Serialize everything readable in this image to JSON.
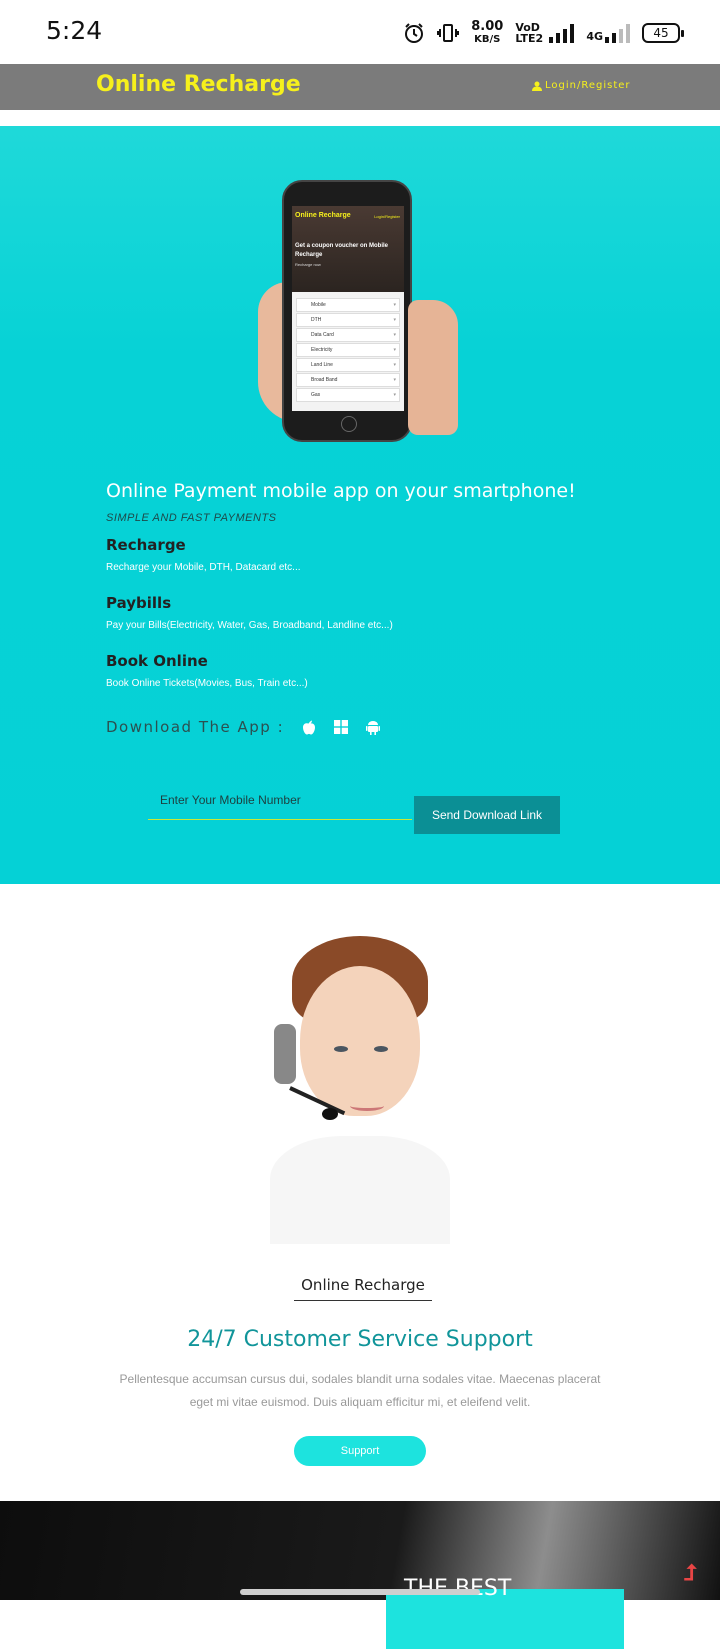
{
  "status": {
    "time": "5:24",
    "speed_value": "8.00",
    "speed_unit": "KB/S",
    "volte": "VoD LTE2",
    "network": "4G",
    "battery": "45"
  },
  "header": {
    "brand": "Online Recharge",
    "login_label": "Login/Register"
  },
  "phone_mock": {
    "title": "Online Recharge",
    "login": "Login/Register",
    "coupon_text": "Get a coupon voucher on Mobile Recharge",
    "recharge_now": "Recharge now",
    "items": [
      "Mobile",
      "DTH",
      "Data Card",
      "Electricity",
      "Land Line",
      "Broad Band",
      "Gas"
    ]
  },
  "hero": {
    "title": "Online Payment mobile app on your smartphone!",
    "subtitle": "SIMPLE AND FAST PAYMENTS",
    "features": [
      {
        "heading": "Recharge",
        "desc": "Recharge your Mobile, DTH, Datacard etc..."
      },
      {
        "heading": "Paybills",
        "desc": "Pay your Bills(Electricity, Water, Gas, Broadband, Landline etc...)"
      },
      {
        "heading": "Book Online",
        "desc": "Book Online Tickets(Movies, Bus, Train etc...)"
      }
    ],
    "download_label": "Download The App :",
    "app_icons": [
      "apple-icon",
      "windows-icon",
      "android-icon"
    ],
    "input_placeholder": "Enter Your Mobile Number",
    "send_button": "Send Download Link"
  },
  "support": {
    "tagline": "Online Recharge",
    "heading": "24/7 Customer Service Support",
    "paragraph": "Pellentesque accumsan cursus dui, sodales blandit urna sodales vitae. Maecenas placerat eget mi vitae euismod. Duis aliquam efficitur mi, et eleifend velit.",
    "button": "Support"
  },
  "footer_banner": {
    "text": "THE BEST"
  },
  "colors": {
    "brand_yellow": "#f6f01c",
    "navbar_gray": "#7b7b7b",
    "hero_cyan": "#05d1d6",
    "teal_button": "#0b8f95",
    "support_button": "#1de3de",
    "heading_teal": "#11959a"
  }
}
